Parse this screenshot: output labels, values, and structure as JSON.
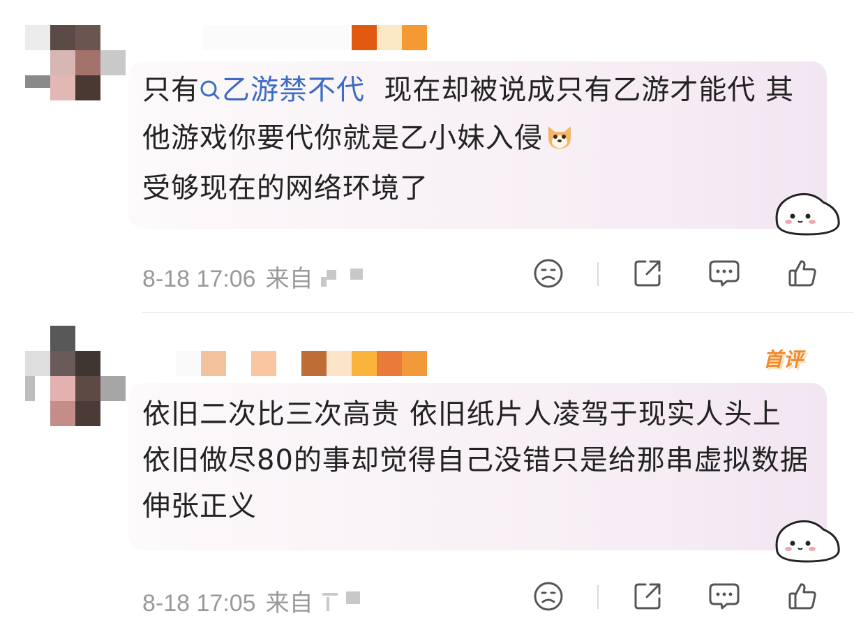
{
  "comments": [
    {
      "topic": "乙游禁不代",
      "text_before": "只有",
      "text_after": "  现在却被说成只有乙游才能代 其他游戏你要代你就是乙小妹入侵",
      "text_end": "受够现在的网络环境了",
      "timestamp": "8-18 17:06",
      "from_label": "来自",
      "emoji": "dog-face",
      "sticker": "white-hamster-sticker"
    },
    {
      "badge": "首评",
      "text": "依旧二次比三次高贵 依旧纸片人凌驾于现实人头上 依旧做尽80的事却觉得自己没错只是给那串虚拟数据伸张正义",
      "timestamp": "8-18 17:05",
      "from_label": "来自",
      "sticker": "white-hamster-sticker"
    }
  ],
  "icons": [
    "dislike-face-icon",
    "share-icon",
    "comment-icon",
    "like-thumb-icon"
  ],
  "colors": {
    "text": "#222222",
    "topic": "#3b6bc4",
    "meta": "#999999",
    "badge": "#f08a2b",
    "bubble": "#f6eef4"
  }
}
